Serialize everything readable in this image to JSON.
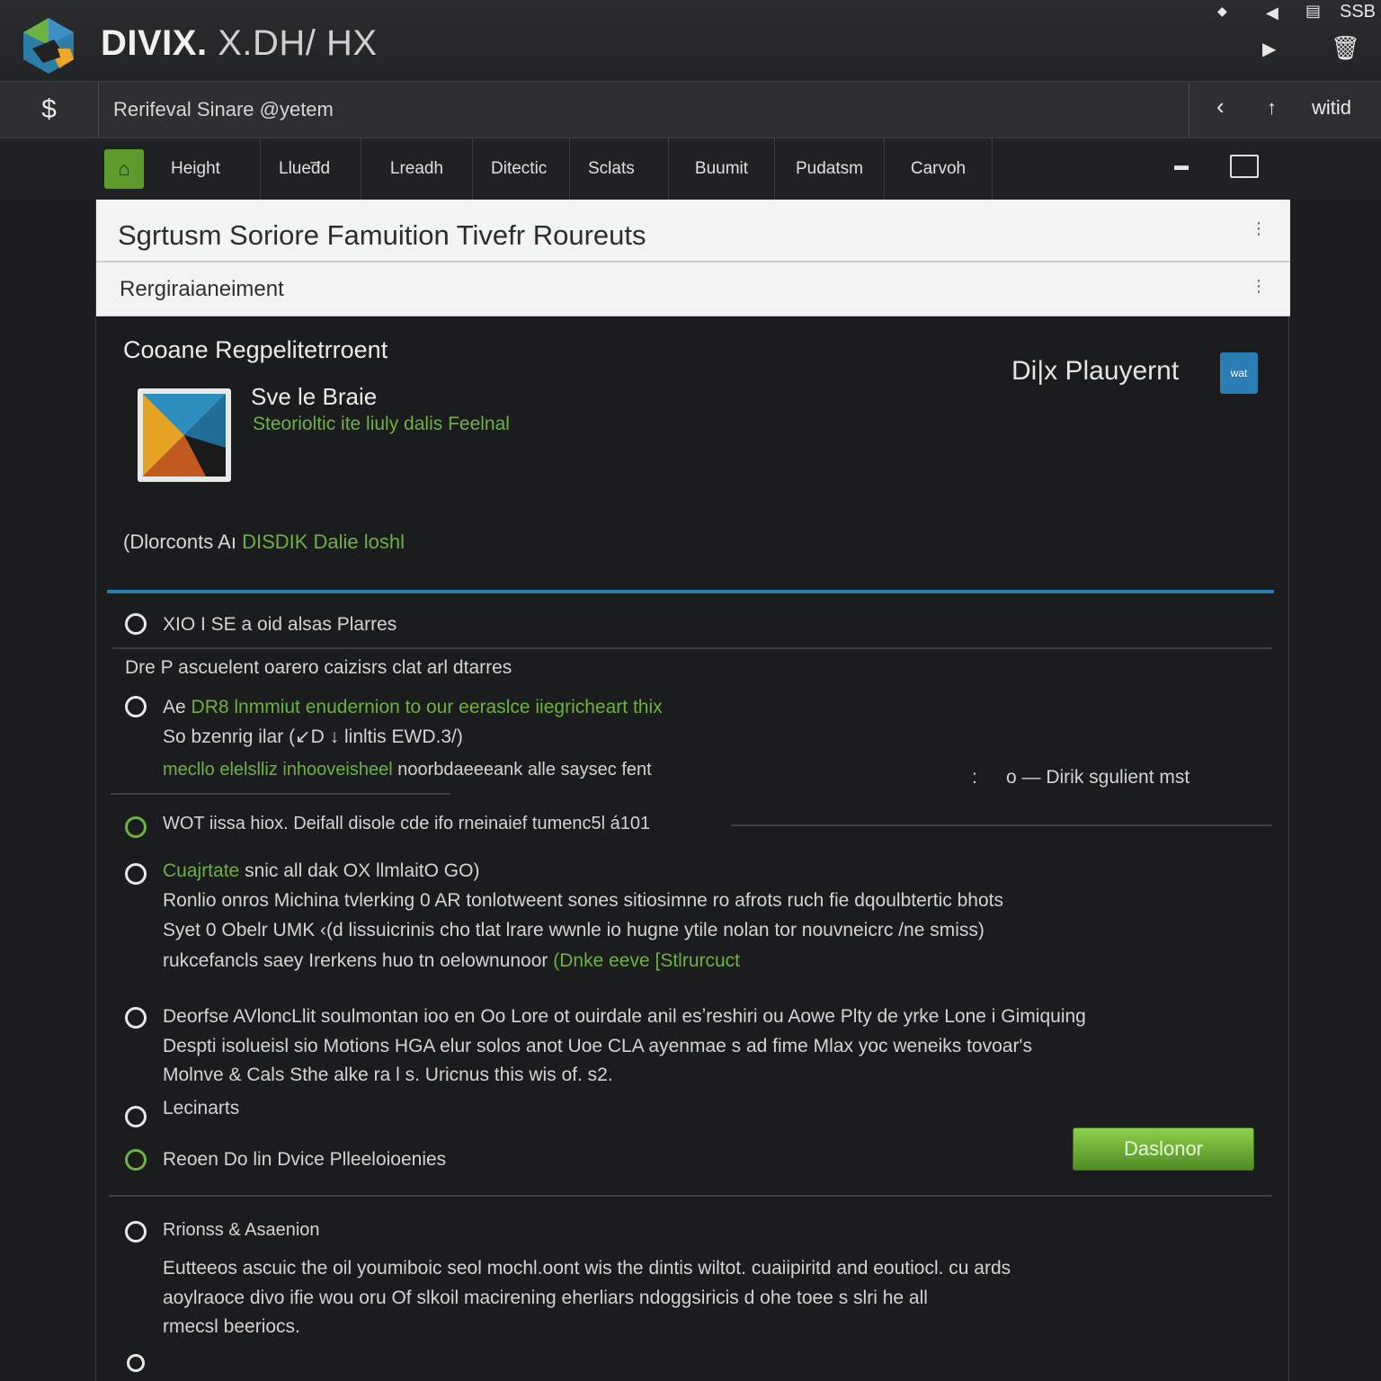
{
  "window": {
    "title": "DIVIX.",
    "title_suffix": "X.DH/ HX",
    "ctl_top_right": "SSB"
  },
  "address": {
    "left_symbol": "$",
    "path": "Rerifeval Sinare  @yetem",
    "right_label": "witid"
  },
  "tabs": [
    "Height",
    "Llued̅d",
    "Lreadh",
    "Ditectic",
    "Sclats",
    "Buumit",
    "Pudatsm",
    "Carvoh"
  ],
  "header": {
    "title": "Sgrtusm Soriore Famuition Tivefr Roureuts",
    "subtitle": "Rergiraianeiment"
  },
  "content": {
    "section_title": "Cooane Regpelitetrroent",
    "product_name": "Sve le Braie",
    "product_desc": "Steorioltic ite liuly dalis Feelnal",
    "brand_label": "Di|x Plauyernt",
    "badge_text": "wat",
    "status_prefix": "(Dlorconts  Aı",
    "status_link": "DISDIK Dalie loshl"
  },
  "options": [
    {
      "label": "XIO I SE a oid alsas Plarres"
    },
    {
      "note": "Dre P ascuelent oarero caizisrs clat arl dtarres"
    },
    {
      "lead": "Ae",
      "link": "DR8 lnmmiut enudernion to our eeraslce iiegricheart thix",
      "line2": "So bzenrig ilar (↙D ↓ linltis EWD.3/)",
      "line3_green": "mecllo elelslliz inhooveisheel",
      "line3_rest": "noorbdaeeeank alle saysec fent",
      "right_colon": ":",
      "right_green": "o — Dirik sgulient mst"
    },
    {
      "label": "WOT iissa hiox. Deifall disole cde ifo rneinaief tumenc5l á101"
    },
    {
      "lead_green": "Cuajrtate",
      "lead_rest": "snic all dak OX llmlaitO GO)",
      "line2": "Ronlio onros Michina tvlerking 0 AR tonlotweent sones sitiosimne ro afrots ruch fie dqoulbtertic bhots",
      "line3": "Syet 0 Obelr UMK ‹(d lissuicrinis cho tlat lrare wwnle io hugne ytile nolan tor nouvneicrc /ne smiss)",
      "line4_prefix": "rukcefancls saey Irerkens huo tn oelownunoor",
      "line4_green": "(Dnke eeve [Stlrurcuct"
    },
    {
      "line1": "Deorfse AVloncLlit soulmontan ioo en Oo Lore ot ouirdale anil esʼreshiri ou Aowe Plty de yrke Lone i Gimiquing",
      "line2": "Despti isolueisl sio Motions HGA elur solos anot Uoe CLA ayenmae s ad fime Mlax yoc weneiks tovoar's",
      "line3": "Molnve & Cals Sthe alke ra l s. Uricnus this  wis of. s2."
    },
    {
      "label": "Lecinarts"
    },
    {
      "label": "Reoen Do lin Dvice Plleeloioenies",
      "button": "Daslonor"
    },
    {
      "title": "Rrionss & Asaenion",
      "line1": "Eutteeos ascuic  the oil youmiboic seol mochl.oont wis the dintis wiltot. cuaiipiritd and eoutiocl. cu ards",
      "line2": "aoylraoce divo  ifie wou oru Of slkoil macirening eherliars ndoggsiricis d ohe  toee s slri he all",
      "line3": "rmecsl beeriocs."
    }
  ],
  "colors": {
    "accent_green": "#6db33f",
    "accent_blue": "#2a7ea8",
    "header_bg": "#f2f3f3"
  }
}
